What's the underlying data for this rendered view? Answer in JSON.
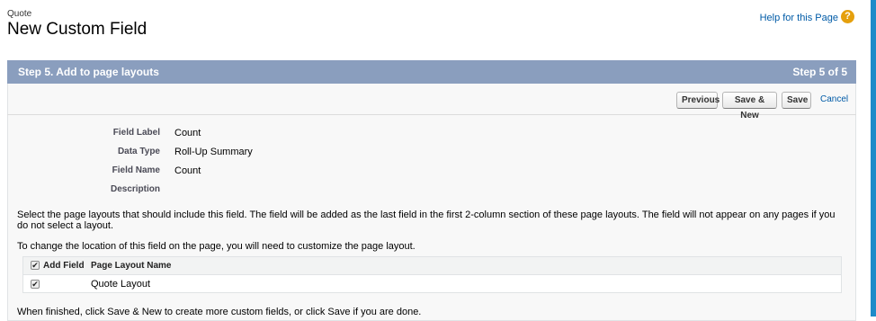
{
  "header": {
    "object_name": "Quote",
    "title": "New Custom Field",
    "help_link": "Help for this Page",
    "help_icon": "?"
  },
  "step": {
    "title": "Step 5. Add to page layouts",
    "count": "Step 5 of 5"
  },
  "buttons": {
    "previous": "Previous",
    "save_new": "Save & New",
    "save": "Save",
    "cancel": "Cancel"
  },
  "details": [
    {
      "label": "Field Label",
      "value": "Count"
    },
    {
      "label": "Data Type",
      "value": "Roll-Up Summary"
    },
    {
      "label": "Field Name",
      "value": "Count"
    },
    {
      "label": "Description",
      "value": ""
    }
  ],
  "instructions": {
    "select_text": "Select the page layouts that should include this field. The field will be added as the last field in the first 2-column section of these page layouts. The field will not appear on any pages if you do not select a layout.",
    "location_text": "To change the location of this field on the page, you will need to customize the page layout.",
    "finished_text": "When finished, click Save & New to create more custom fields, or click Save if you are done."
  },
  "layout_table": {
    "headers": {
      "add_field": "Add Field",
      "layout_name": "Page Layout Name"
    },
    "select_all_checked": true,
    "rows": [
      {
        "checked": true,
        "name": "Quote Layout"
      }
    ]
  },
  "colors": {
    "step_header_bg": "#8a9ebe",
    "link": "#015ba7",
    "help_icon": "#e5a00d",
    "right_edge": "#1d8bc9"
  }
}
